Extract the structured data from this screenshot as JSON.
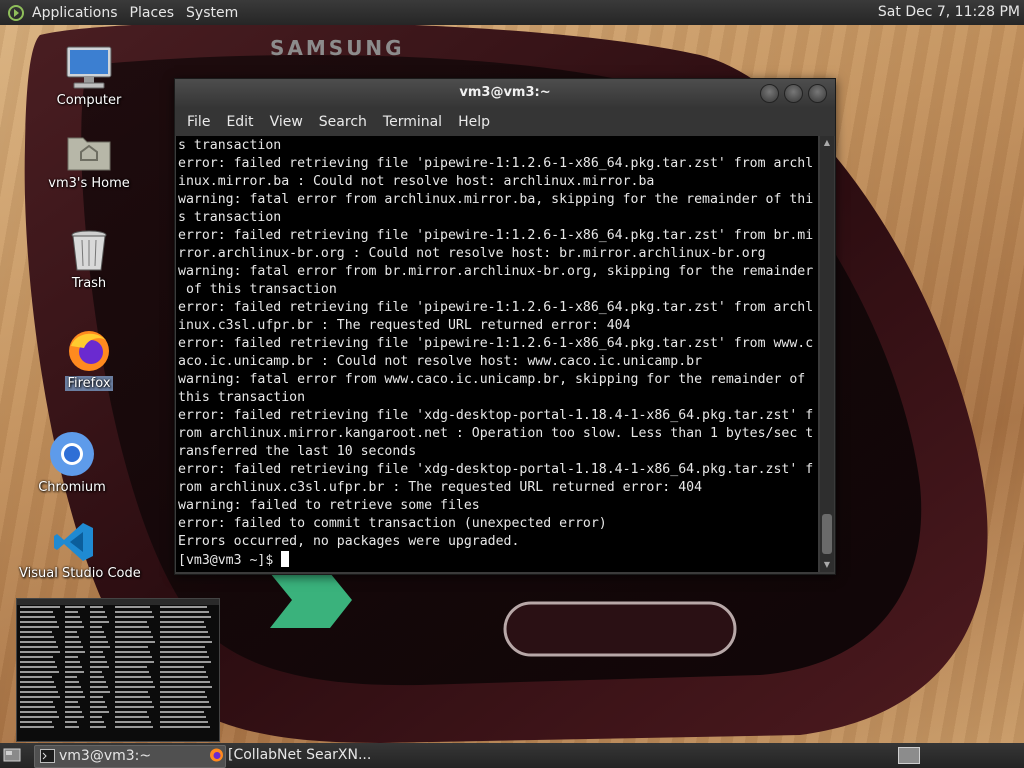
{
  "top_panel": {
    "menus": [
      "Applications",
      "Places",
      "System"
    ],
    "clock": "Sat Dec  7, 11:28 PM"
  },
  "desktop_icons": [
    {
      "label": "Computer",
      "icon": "computer-icon"
    },
    {
      "label": "vm3's Home",
      "icon": "home-folder-icon"
    },
    {
      "label": "Trash",
      "icon": "trash-icon"
    },
    {
      "label": "Firefox",
      "icon": "firefox-icon"
    },
    {
      "label": "Chromium",
      "icon": "chromium-icon"
    },
    {
      "label": "Visual Studio Code",
      "icon": "vscode-icon"
    }
  ],
  "wallpaper": {
    "phone_brand": "SAMSUNG"
  },
  "terminal": {
    "title": "vm3@vm3:~",
    "menu": [
      "File",
      "Edit",
      "View",
      "Search",
      "Terminal",
      "Help"
    ],
    "lines": [
      "s transaction",
      "error: failed retrieving file 'pipewire-1:1.2.6-1-x86_64.pkg.tar.zst' from archl",
      "inux.mirror.ba : Could not resolve host: archlinux.mirror.ba",
      "warning: fatal error from archlinux.mirror.ba, skipping for the remainder of thi",
      "s transaction",
      "error: failed retrieving file 'pipewire-1:1.2.6-1-x86_64.pkg.tar.zst' from br.mi",
      "rror.archlinux-br.org : Could not resolve host: br.mirror.archlinux-br.org",
      "warning: fatal error from br.mirror.archlinux-br.org, skipping for the remainder",
      " of this transaction",
      "error: failed retrieving file 'pipewire-1:1.2.6-1-x86_64.pkg.tar.zst' from archl",
      "inux.c3sl.ufpr.br : The requested URL returned error: 404",
      "error: failed retrieving file 'pipewire-1:1.2.6-1-x86_64.pkg.tar.zst' from www.c",
      "aco.ic.unicamp.br : Could not resolve host: www.caco.ic.unicamp.br",
      "warning: fatal error from www.caco.ic.unicamp.br, skipping for the remainder of",
      "this transaction",
      "error: failed retrieving file 'xdg-desktop-portal-1.18.4-1-x86_64.pkg.tar.zst' f",
      "rom archlinux.mirror.kangaroot.net : Operation too slow. Less than 1 bytes/sec t",
      "ransferred the last 10 seconds",
      "error: failed retrieving file 'xdg-desktop-portal-1.18.4-1-x86_64.pkg.tar.zst' f",
      "rom archlinux.c3sl.ufpr.br : The requested URL returned error: 404",
      "warning: failed to retrieve some files",
      "error: failed to commit transaction (unexpected error)",
      "Errors occurred, no packages were upgraded."
    ],
    "prompt": "[vm3@vm3 ~]$ "
  },
  "taskbar": {
    "tasks": [
      {
        "label": "vm3@vm3:~",
        "icon": "terminal-icon",
        "active": true
      },
      {
        "label": "[CollabNet SearXN...",
        "icon": "firefox-icon",
        "active": false
      }
    ]
  }
}
